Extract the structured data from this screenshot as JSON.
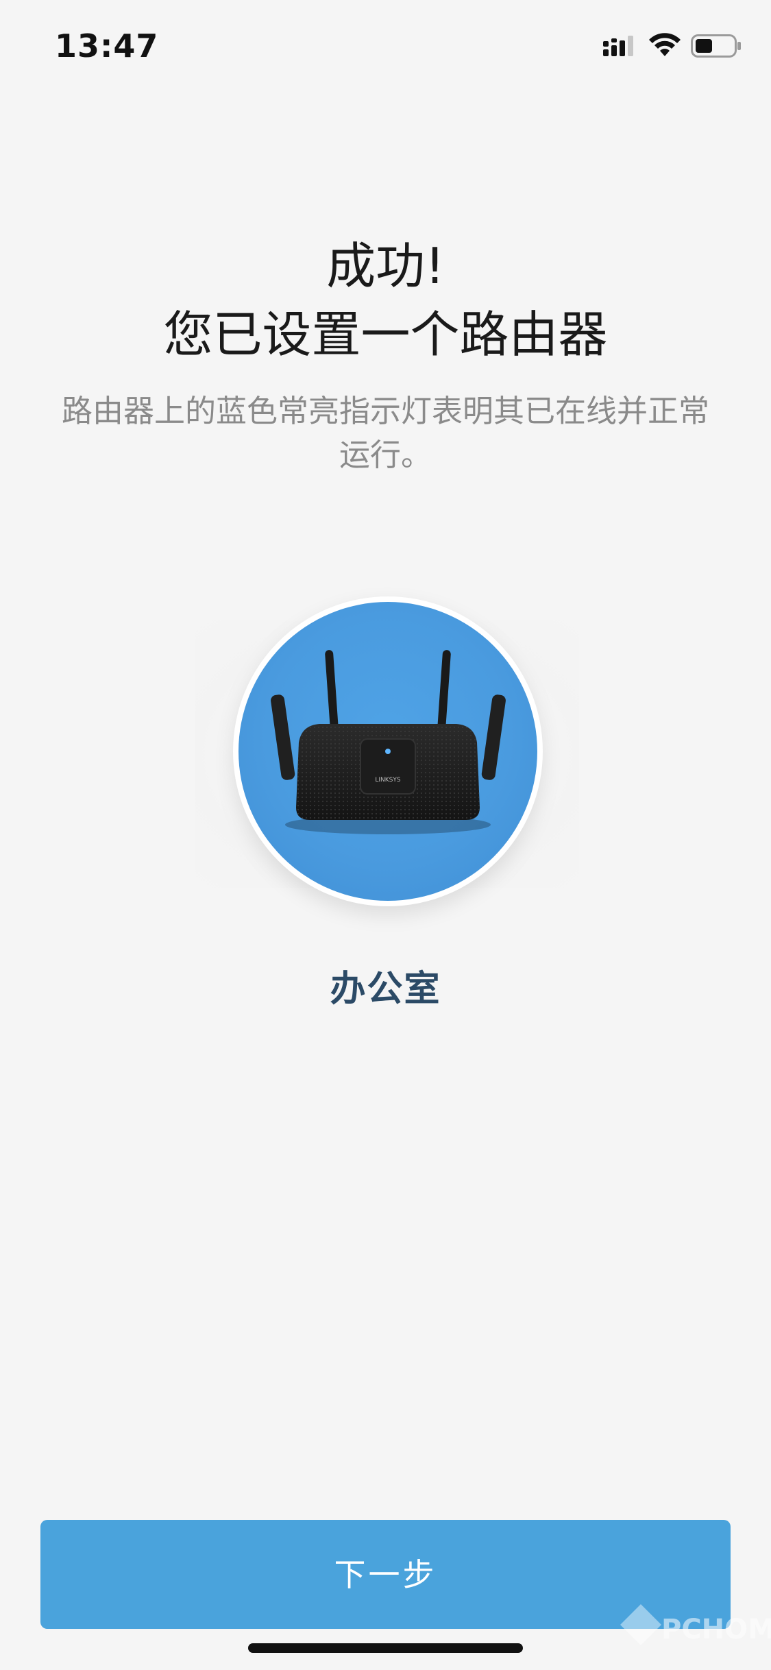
{
  "status_bar": {
    "time": "13:47",
    "signal_icon": "cellular-signal-icon",
    "wifi_icon": "wifi-icon",
    "battery_icon": "battery-icon",
    "battery_level": 0.45
  },
  "header": {
    "title_line1": "成功!",
    "title_line2": "您已设置一个路由器",
    "subtitle": "路由器上的蓝色常亮指示灯表明其已在线并正常运行。"
  },
  "router": {
    "image_icon": "router-icon",
    "brand_label": "LINKSYS",
    "name": "办公室",
    "circle_color": "#4a9bdf"
  },
  "actions": {
    "next_label": "下一步",
    "button_color": "#4aa3dc"
  },
  "watermark": {
    "text": "PCHOME"
  }
}
